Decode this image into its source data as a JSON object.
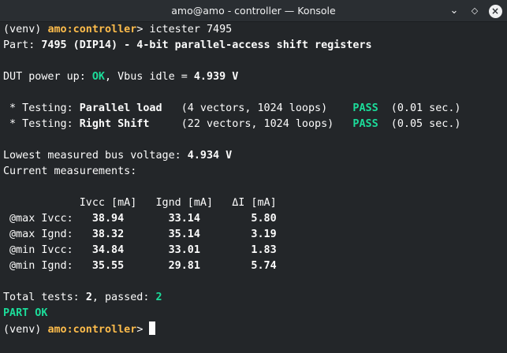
{
  "window": {
    "title": "amo@amo - controller — Konsole",
    "minimize_glyph": "⌄",
    "maximize_glyph": "◇",
    "close_glyph": "×"
  },
  "colors": {
    "background": "#232629",
    "titlebar": "#2a2e32",
    "text": "#fcfcfc",
    "green": "#1cdc9a",
    "yellow": "#fdbc4b"
  },
  "prompt": {
    "venv": "(venv) ",
    "location": "amo:controller",
    "symbol": "> "
  },
  "command": "ictester 7495",
  "part": {
    "label": "Part: ",
    "name": "7495 (DIP14) - 4-bit parallel-access shift registers"
  },
  "power": {
    "label": "DUT power up: ",
    "status": "OK",
    "vbus_label": ", Vbus idle = ",
    "vbus_value": "4.939 V"
  },
  "tests": [
    {
      "prefix": " * Testing: ",
      "name": "Parallel load ",
      "detail": "  (4 vectors, 1024 loops)    ",
      "result": "PASS",
      "time": "  (0.01 sec.)"
    },
    {
      "prefix": " * Testing: ",
      "name": "Right Shift   ",
      "detail": "  (22 vectors, 1024 loops)   ",
      "result": "PASS",
      "time": "  (0.05 sec.)"
    }
  ],
  "lowest": {
    "label": "Lowest measured bus voltage: ",
    "value": "4.934 V"
  },
  "current_label": "Current measurements:",
  "table": {
    "header": "            Ivcc [mA]   Ignd [mA]   ΔI [mA]",
    "rows": [
      {
        "label": " @max Ivcc:  ",
        "ivcc": " 38.94",
        "ignd": "       33.14",
        "di": "        5.80"
      },
      {
        "label": " @max Ignd:  ",
        "ivcc": " 38.32",
        "ignd": "       35.14",
        "di": "        3.19"
      },
      {
        "label": " @min Ivcc:  ",
        "ivcc": " 34.84",
        "ignd": "       33.01",
        "di": "        1.83"
      },
      {
        "label": " @min Ignd:  ",
        "ivcc": " 35.55",
        "ignd": "       29.81",
        "di": "        5.74"
      }
    ]
  },
  "summary": {
    "label": "Total tests: ",
    "total": "2",
    "passed_label": ", passed: ",
    "passed": "2"
  },
  "final": "PART OK"
}
